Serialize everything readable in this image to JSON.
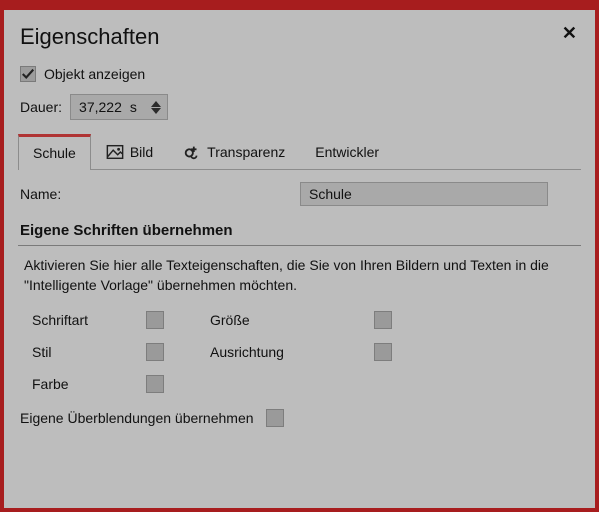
{
  "header": {
    "title": "Eigenschaften"
  },
  "show_object": {
    "label": "Objekt anzeigen",
    "checked": true
  },
  "duration": {
    "label": "Dauer:",
    "value": "37,222",
    "unit": "s"
  },
  "tabs": {
    "items": [
      {
        "label": "Schule",
        "active": true
      },
      {
        "label": "Bild",
        "active": false
      },
      {
        "label": "Transparenz",
        "active": false
      },
      {
        "label": "Entwickler",
        "active": false
      }
    ]
  },
  "name_field": {
    "label": "Name:",
    "value": "Schule"
  },
  "custom_fonts": {
    "heading": "Eigene Schriften übernehmen",
    "help": "Aktivieren Sie hier alle Texteigenschaften, die Sie von Ihren Bildern und Texten in die \"Intelligente Vorlage\" übernehmen möchten.",
    "options": {
      "schriftart": "Schriftart",
      "stil": "Stil",
      "farbe": "Farbe",
      "groesse": "Größe",
      "ausrichtung": "Ausrichtung"
    }
  },
  "overblend": {
    "label": "Eigene Überblendungen übernehmen"
  }
}
